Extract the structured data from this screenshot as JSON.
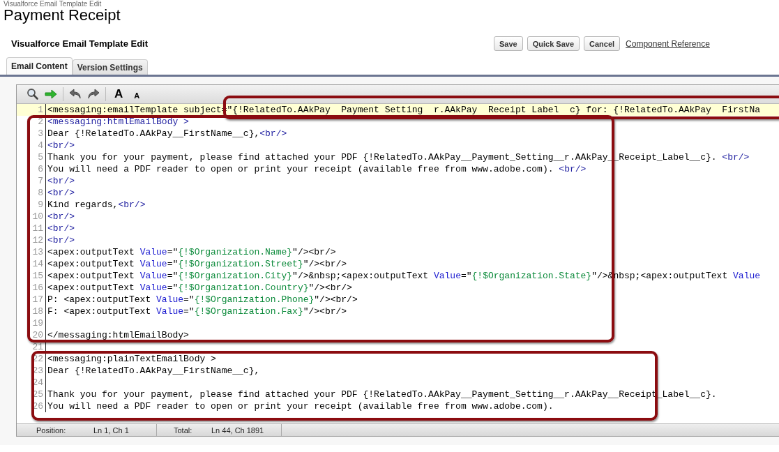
{
  "page": {
    "breadcrumb": "Visualforce Email Template Edit",
    "title": "Payment Receipt"
  },
  "section": {
    "title": "Visualforce Email Template Edit",
    "buttons": [
      "Save",
      "Quick Save",
      "Cancel"
    ],
    "link": "Component Reference"
  },
  "tabs": [
    {
      "label": "Email Content",
      "selected": true
    },
    {
      "label": "Version Settings",
      "selected": false
    }
  ],
  "editor": {
    "toolbar": [
      {
        "kind": "search"
      },
      {
        "kind": "go"
      },
      {
        "kind": "separator"
      },
      {
        "kind": "undo"
      },
      {
        "kind": "redo"
      },
      {
        "kind": "separator"
      },
      {
        "kind": "font-larger",
        "label": "A"
      },
      {
        "kind": "font-smaller",
        "label": "A"
      }
    ],
    "lines": [
      {
        "number": "1",
        "current": true,
        "segments": [
          {
            "kind": "text",
            "text": "<messaging:emailTemplate subject="
          },
          {
            "kind": "text",
            "text": "\"{!RelatedTo.AAkPay  Payment Setting  r.AAkPay  Receipt Label  c} for: {!RelatedTo.AAkPay  FirstNa"
          }
        ]
      },
      {
        "number": "2",
        "current": false,
        "segments": [
          {
            "kind": "tag",
            "text": "<messaging:htmlEmailBody >"
          }
        ]
      },
      {
        "number": "3",
        "current": false,
        "segments": [
          {
            "kind": "text",
            "text": "Dear {!RelatedTo.AAkPay__FirstName__c},"
          },
          {
            "kind": "tag",
            "text": "<br/>"
          }
        ]
      },
      {
        "number": "4",
        "current": false,
        "segments": [
          {
            "kind": "tag",
            "text": "<br/>"
          }
        ]
      },
      {
        "number": "5",
        "current": false,
        "segments": [
          {
            "kind": "text",
            "text": "Thank you for your payment, please find attached your PDF {!RelatedTo.AAkPay__Payment_Setting__r.AAkPay__Receipt_Label__c}. "
          },
          {
            "kind": "tag",
            "text": "<br/>"
          }
        ]
      },
      {
        "number": "6",
        "current": false,
        "segments": [
          {
            "kind": "text",
            "text": "You will need a PDF reader to open or print your receipt (available free from www.adobe.com). "
          },
          {
            "kind": "tag",
            "text": "<br/>"
          }
        ]
      },
      {
        "number": "7",
        "current": false,
        "segments": [
          {
            "kind": "tag",
            "text": "<br/>"
          }
        ]
      },
      {
        "number": "8",
        "current": false,
        "segments": [
          {
            "kind": "tag",
            "text": "<br/>"
          }
        ]
      },
      {
        "number": "9",
        "current": false,
        "segments": [
          {
            "kind": "text",
            "text": "Kind regards,"
          },
          {
            "kind": "tag",
            "text": "<br/>"
          }
        ]
      },
      {
        "number": "10",
        "current": false,
        "segments": [
          {
            "kind": "tag",
            "text": "<br/>"
          }
        ]
      },
      {
        "number": "11",
        "current": false,
        "segments": [
          {
            "kind": "tag",
            "text": "<br/>"
          }
        ]
      },
      {
        "number": "12",
        "current": false,
        "segments": [
          {
            "kind": "tag",
            "text": "<br/>"
          }
        ]
      },
      {
        "number": "13",
        "current": false,
        "segments": [
          {
            "kind": "text",
            "text": "<apex:outputText "
          },
          {
            "kind": "attr",
            "text": "Value"
          },
          {
            "kind": "text",
            "text": "=\""
          },
          {
            "kind": "string",
            "text": "{!$Organization.Name}"
          },
          {
            "kind": "text",
            "text": "\"/><br/>"
          }
        ]
      },
      {
        "number": "14",
        "current": false,
        "segments": [
          {
            "kind": "text",
            "text": "<apex:outputText "
          },
          {
            "kind": "attr",
            "text": "Value"
          },
          {
            "kind": "text",
            "text": "=\""
          },
          {
            "kind": "string",
            "text": "{!$Organization.Street}"
          },
          {
            "kind": "text",
            "text": "\"/><br/>"
          }
        ]
      },
      {
        "number": "15",
        "current": false,
        "segments": [
          {
            "kind": "text",
            "text": "<apex:outputText "
          },
          {
            "kind": "attr",
            "text": "Value"
          },
          {
            "kind": "text",
            "text": "=\""
          },
          {
            "kind": "string",
            "text": "{!$Organization.City}"
          },
          {
            "kind": "text",
            "text": "\"/>&nbsp;<apex:outputText "
          },
          {
            "kind": "attr",
            "text": "Value"
          },
          {
            "kind": "text",
            "text": "=\""
          },
          {
            "kind": "string",
            "text": "{!$Organization.State}"
          },
          {
            "kind": "text",
            "text": "\"/>&nbsp;<apex:outputText "
          },
          {
            "kind": "attr",
            "text": "Value"
          }
        ]
      },
      {
        "number": "16",
        "current": false,
        "segments": [
          {
            "kind": "text",
            "text": "<apex:outputText "
          },
          {
            "kind": "attr",
            "text": "Value"
          },
          {
            "kind": "text",
            "text": "=\""
          },
          {
            "kind": "string",
            "text": "{!$Organization.Country}"
          },
          {
            "kind": "text",
            "text": "\"/><br/>"
          }
        ]
      },
      {
        "number": "17",
        "current": false,
        "segments": [
          {
            "kind": "text",
            "text": "P: <apex:outputText "
          },
          {
            "kind": "attr",
            "text": "Value"
          },
          {
            "kind": "text",
            "text": "=\""
          },
          {
            "kind": "string",
            "text": "{!$Organization.Phone}"
          },
          {
            "kind": "text",
            "text": "\"/><br/>"
          }
        ]
      },
      {
        "number": "18",
        "current": false,
        "segments": [
          {
            "kind": "text",
            "text": "F: <apex:outputText "
          },
          {
            "kind": "attr",
            "text": "Value"
          },
          {
            "kind": "text",
            "text": "=\""
          },
          {
            "kind": "string",
            "text": "{!$Organization.Fax}"
          },
          {
            "kind": "text",
            "text": "\"/><br/>"
          }
        ]
      },
      {
        "number": "19",
        "current": false
      },
      {
        "number": "20",
        "current": false,
        "segments": [
          {
            "kind": "text",
            "text": "</messaging:htmlEmailBody>"
          }
        ]
      },
      {
        "number": "21",
        "current": false
      },
      {
        "number": "22",
        "current": false,
        "segments": [
          {
            "kind": "text",
            "text": "<messaging:plainTextEmailBody >"
          }
        ]
      },
      {
        "number": "23",
        "current": false,
        "segments": [
          {
            "kind": "text",
            "text": "Dear {!RelatedTo.AAkPay__FirstName__c},"
          }
        ]
      },
      {
        "number": "24",
        "current": false
      },
      {
        "number": "25",
        "current": false,
        "segments": [
          {
            "kind": "text",
            "text": "Thank you for your payment, please find attached your PDF {!RelatedTo.AAkPay__Payment_Setting__r.AAkPay__Receipt_Label__c}."
          }
        ]
      },
      {
        "number": "26",
        "current": false,
        "segments": [
          {
            "kind": "text",
            "text": "You will need a PDF reader to open or print your receipt (available free from www.adobe.com)."
          }
        ]
      }
    ],
    "status": {
      "position_label": "Position:",
      "position": "Ln 1, Ch 1",
      "total_label": "Total:",
      "total": "Ln 44, Ch 1891"
    }
  }
}
